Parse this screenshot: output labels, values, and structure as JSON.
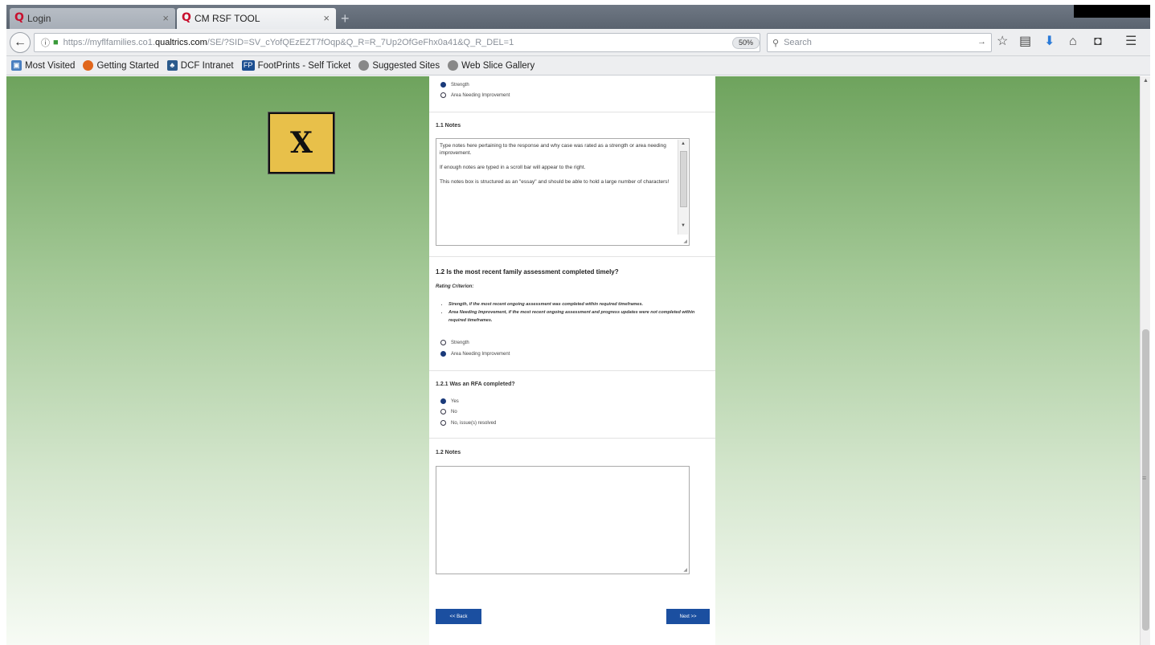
{
  "browser": {
    "tabs": [
      {
        "label": "Login",
        "active": false
      },
      {
        "label": "CM RSF TOOL",
        "active": true
      }
    ],
    "url": {
      "prefix": "https://myflfamilies.co1.",
      "host": "qualtrics.com",
      "path": "/SE/?SID=SV_cYofQEzEZT7fOqp&Q_R=R_7Up2OfGeFhx0a41&Q_R_DEL=1"
    },
    "zoom": "50%",
    "search_placeholder": "Search",
    "bookmarks": [
      {
        "label": "Most Visited",
        "icon": "bookmark-folder-icon",
        "color": "#4a7fc0"
      },
      {
        "label": "Getting Started",
        "icon": "firefox-icon",
        "color": "#e0661c"
      },
      {
        "label": "DCF Intranet",
        "icon": "dcf-icon",
        "color": "#2b5a8c"
      },
      {
        "label": "FootPrints - Self Ticket",
        "icon": "footprints-icon",
        "color": "#1d4f91"
      },
      {
        "label": "Suggested Sites",
        "icon": "globe-icon",
        "color": "#888888"
      },
      {
        "label": "Web Slice Gallery",
        "icon": "globe-icon",
        "color": "#888888"
      }
    ]
  },
  "overlay": {
    "x_label": "X",
    "color": "#e8c04a"
  },
  "survey": {
    "top_options": [
      {
        "label": "Strength",
        "selected": true
      },
      {
        "label": "Area Needing Improvement",
        "selected": false
      }
    ],
    "notes_1_1": {
      "label": "1.1 Notes",
      "paragraphs": [
        "Type notes here pertaining to the response and why case was rated as a strength or area needing improvement.",
        "If enough notes are typed in a scroll bar will appear to the right.",
        "This notes box is structured as an \"essay\" and should be able to hold a large number of characters!"
      ]
    },
    "q1_2": {
      "title": "1.2  Is the most recent family assessment completed timely?",
      "criteria_label": "Rating Criterion:",
      "criteria": [
        "Strength, if the most recent ongoing assessment was completed within required timeframes.",
        "Area Needing Improvement, if the most recent ongoing assessment and progress updates were not completed within required timeframes."
      ],
      "options": [
        {
          "label": "Strength",
          "selected": false
        },
        {
          "label": "Area Needing Improvement",
          "selected": true
        }
      ]
    },
    "q1_2_1": {
      "title": "1.2.1 Was an RFA completed?",
      "options": [
        {
          "label": "Yes",
          "selected": true
        },
        {
          "label": "No",
          "selected": false
        },
        {
          "label": "No, issue(s) resolved",
          "selected": false
        }
      ]
    },
    "notes_1_2": {
      "label": "1.2 Notes",
      "value": ""
    },
    "back_label": "<< Back",
    "next_label": "Next >>"
  },
  "colors": {
    "button": "#1b4fa0",
    "radio_selected": "#1a3a7a"
  }
}
